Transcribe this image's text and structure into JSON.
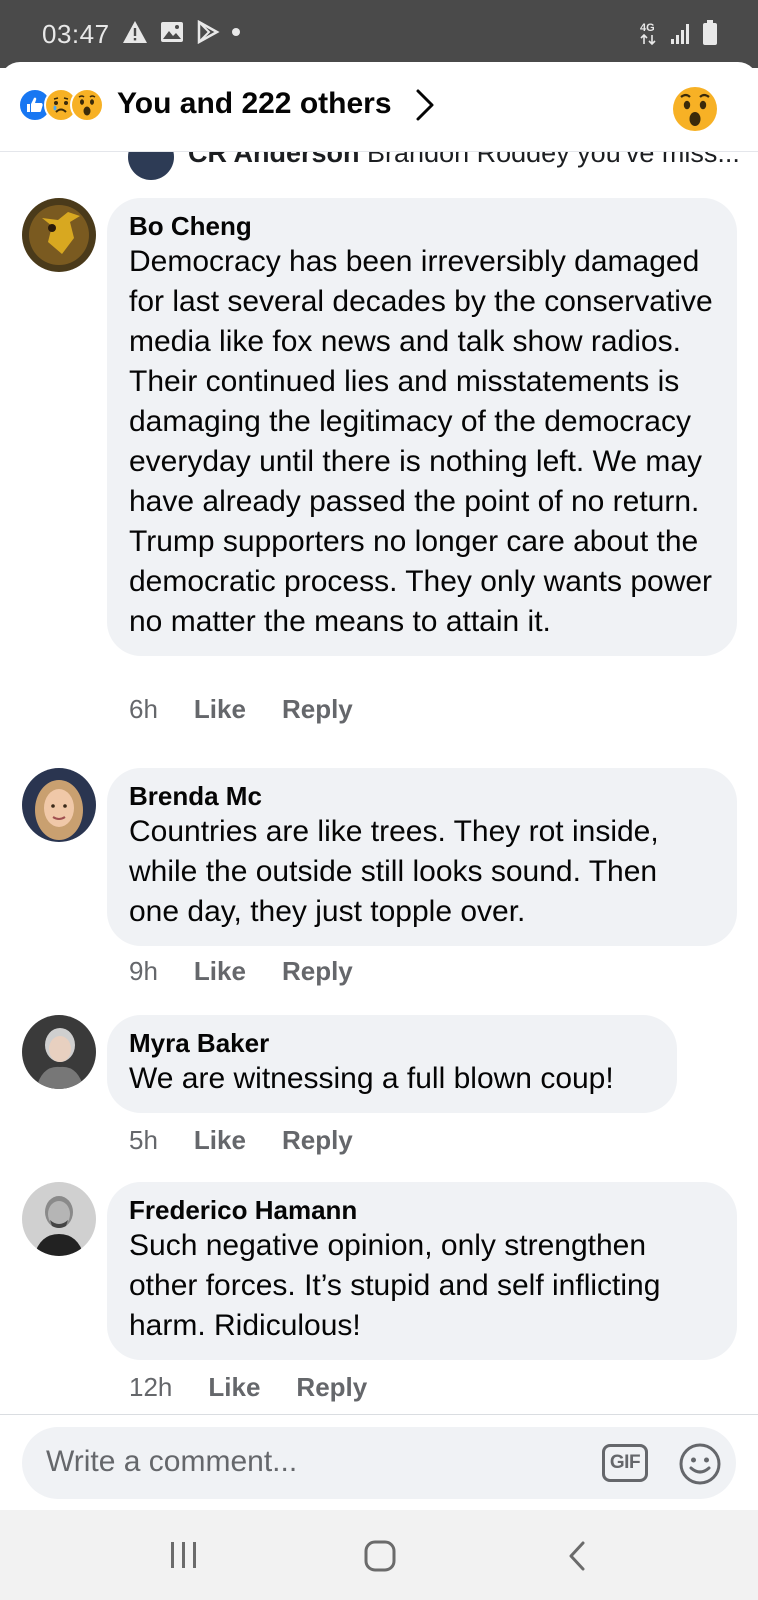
{
  "status_bar": {
    "time": "03:47",
    "network": "4G",
    "icons_left": [
      "warning-icon",
      "gallery-icon",
      "play-store-icon",
      "dot-icon"
    ],
    "icons_right": [
      "network-4g-icon",
      "signal-icon",
      "battery-icon"
    ]
  },
  "reactions_header": {
    "reaction_types": [
      "like",
      "sad",
      "wow"
    ],
    "summary": "You and 222 others",
    "current_reaction": "wow"
  },
  "previous_comment": {
    "author": "CR Anderson",
    "text": "Brandon Roddey  you've miss..."
  },
  "comments": [
    {
      "author": "Bo Cheng",
      "text": "Democracy has been irreversibly damaged for last several decades by the conservative media like fox news and talk show radios. Their continued lies and misstatements is damaging the legitimacy of the democracy everyday until there is nothing left. We may have already passed the point of no return. Trump supporters no longer care about the democratic process. They only wants power no matter the means to attain it.",
      "time": "6h",
      "like_label": "Like",
      "reply_label": "Reply"
    },
    {
      "author": "Brenda Mc",
      "text": "Countries are like trees.  They  rot inside, while the outside still looks sound.  Then one day, they just topple over.",
      "time": "9h",
      "like_label": "Like",
      "reply_label": "Reply"
    },
    {
      "author": "Myra Baker",
      "text": "We are witnessing a full blown coup!",
      "time": "5h",
      "like_label": "Like",
      "reply_label": "Reply"
    },
    {
      "author": "Frederico Hamann",
      "text": "Such negative opinion, only strengthen other forces. It’s stupid and self inflicting harm. Ridiculous!",
      "time": "12h",
      "like_label": "Like",
      "reply_label": "Reply"
    }
  ],
  "composer": {
    "placeholder": "Write a comment...",
    "gif_label": "GIF"
  },
  "colors": {
    "status_bar_bg": "#4a4a4a",
    "bubble_bg": "#f0f2f5",
    "meta_text": "#65676b",
    "like_blue": "#1877f2",
    "reaction_yellow": "#f7b125"
  }
}
